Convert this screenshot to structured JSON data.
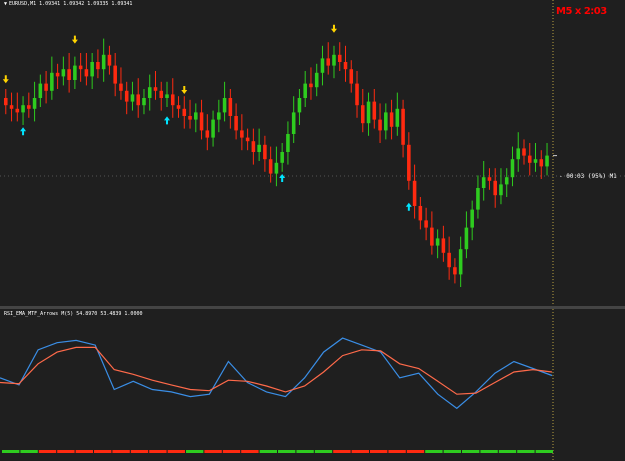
{
  "chart": {
    "symbol_header": "EURUSD,M1  1.09341 1.09342 1.09335 1.09341",
    "timer_label": "M5 x 2:03",
    "price_label": "- 00:03 (95%) M1",
    "indicator_header": "RSI_EMA_MTF_Arrows M(5) 54.8970 53.4839 1.0000"
  },
  "colors": {
    "background": "#1f1f1f",
    "grid": "#3a3a3a",
    "bull": "#2ecc1f",
    "bear": "#ff2a10",
    "arrow_up": "#00e5ff",
    "arrow_down": "#ffd400",
    "rsi_line": "#3a8ee6",
    "ema_line": "#ff6a4a",
    "timer": "#ff0000"
  },
  "chart_data": [
    {
      "type": "candlestick",
      "title": "",
      "closes": [
        1.0925,
        1.0924,
        1.0923,
        1.0925,
        1.0924,
        1.0927,
        1.0931,
        1.0929,
        1.0934,
        1.0933,
        1.0935,
        1.0932,
        1.0936,
        1.0935,
        1.0933,
        1.0937,
        1.0935,
        1.0939,
        1.0936,
        1.0931,
        1.0929,
        1.0926,
        1.0928,
        1.0925,
        1.0927,
        1.093,
        1.0929,
        1.0927,
        1.0928,
        1.0925,
        1.0924,
        1.0922,
        1.0921,
        1.0923,
        1.0918,
        1.0916,
        1.0921,
        1.0923,
        1.0927,
        1.0922,
        1.0918,
        1.0916,
        1.0915,
        1.0912,
        1.0914,
        1.091,
        1.0906,
        1.0909,
        1.0912,
        1.0917,
        1.0923,
        1.0927,
        1.0931,
        1.093,
        1.0934,
        1.0938,
        1.0936,
        1.0939,
        1.0937,
        1.0935,
        1.0931,
        1.0925,
        1.092,
        1.0926,
        1.0921,
        1.0918,
        1.0923,
        1.0919,
        1.0924,
        1.0914,
        1.0904,
        1.0897,
        1.0893,
        1.0891,
        1.0886,
        1.0888,
        1.0884,
        1.088,
        1.0878,
        1.0885,
        1.0891,
        1.0896,
        1.0902,
        1.0905,
        1.0904,
        1.09,
        1.0903,
        1.0905,
        1.091,
        1.0913,
        1.0911,
        1.0909,
        1.091,
        1.0908,
        1.0911
      ],
      "signals_up": [
        3,
        28,
        48,
        70
      ],
      "signals_down": [
        0,
        12,
        31,
        57
      ],
      "current_price_line": 1.0911,
      "ylim": [
        1.0872,
        1.0952
      ]
    },
    {
      "type": "line",
      "title": "",
      "ylim": [
        0,
        100
      ],
      "series": [
        {
          "values": [
            48,
            42,
            72,
            78,
            80,
            76,
            38,
            45,
            38,
            36,
            32,
            34,
            62,
            44,
            36,
            32,
            48,
            70,
            82,
            76,
            70,
            48,
            52,
            34,
            22,
            36,
            52,
            62,
            56,
            50
          ]
        },
        {
          "values": [
            44,
            43,
            60,
            70,
            74,
            74,
            55,
            51,
            46,
            42,
            38,
            37,
            46,
            45,
            41,
            36,
            41,
            53,
            67,
            72,
            71,
            60,
            56,
            45,
            34,
            35,
            44,
            53,
            55,
            53
          ]
        }
      ],
      "signal_bar": [
        1,
        1,
        0,
        0,
        0,
        0,
        0,
        0,
        0,
        0,
        1,
        0,
        0,
        0,
        1,
        1,
        1,
        1,
        0,
        0,
        0,
        0,
        0,
        1,
        1,
        1,
        1,
        1,
        1,
        1
      ]
    }
  ]
}
